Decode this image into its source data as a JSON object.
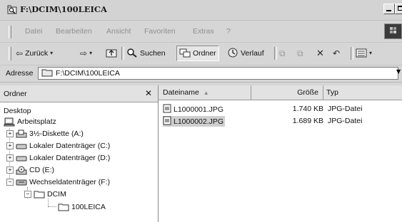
{
  "window": {
    "title": "F:\\DCIM\\100LEICA"
  },
  "menubar": {
    "items": [
      "Datei",
      "Bearbeiten",
      "Ansicht",
      "Favoriten",
      "Extras",
      "?"
    ]
  },
  "toolbar": {
    "back_label": "Zurück",
    "search_label": "Suchen",
    "folders_label": "Ordner",
    "history_label": "Verlauf"
  },
  "address": {
    "label": "Adresse",
    "value": "F:\\DCIM\\100LEICA"
  },
  "folder_pane": {
    "title": "Ordner",
    "close_glyph": "✕",
    "tree": [
      {
        "label": "Desktop",
        "icon": "none"
      },
      {
        "label": "Arbeitsplatz",
        "icon": "computer-icon"
      },
      {
        "label": "3½-Diskette (A:)",
        "icon": "floppy-drive-icon"
      },
      {
        "label": "Lokaler Datenträger (C:)",
        "icon": "hard-drive-icon"
      },
      {
        "label": "Lokaler Datenträger (D:)",
        "icon": "hard-drive-icon"
      },
      {
        "label": "CD (E:)",
        "icon": "cd-drive-icon"
      },
      {
        "label": "Wechseldatenträger (F:)",
        "icon": "removable-drive-icon"
      },
      {
        "label": "DCIM",
        "icon": "folder-icon"
      },
      {
        "label": "100LEICA",
        "icon": "folder-icon"
      }
    ]
  },
  "file_list": {
    "columns": [
      "Dateiname",
      "Größe",
      "Typ"
    ],
    "sort_indicator": "▲",
    "files": [
      {
        "name": "L1000001.JPG",
        "size": "1.740 KB",
        "type": "JPG-Datei",
        "selected": false
      },
      {
        "name": "L1000002.JPG",
        "size": "1.689 KB",
        "type": "JPG-Datei",
        "selected": true
      }
    ]
  }
}
